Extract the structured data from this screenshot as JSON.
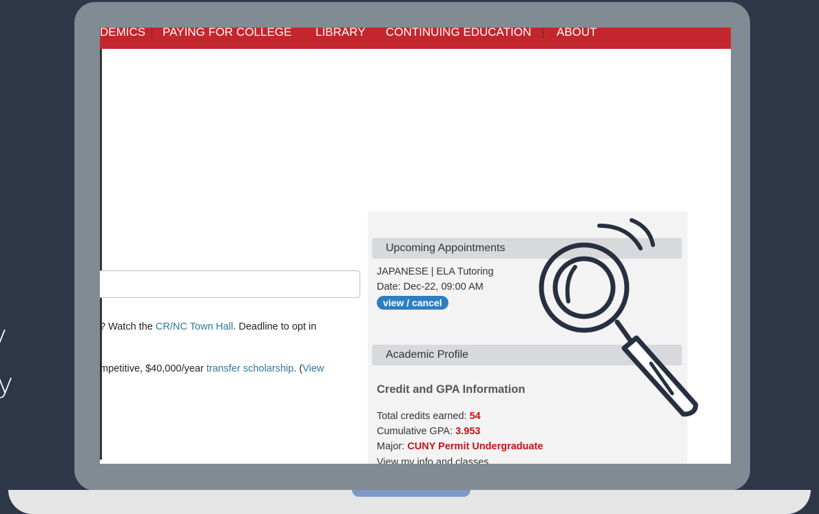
{
  "slide_text": {
    "line1": "ny",
    "line2": "My"
  },
  "nav": {
    "items": [
      "DEMICS",
      "PAYING FOR COLLEGE",
      "LIBRARY",
      "CONTINUING EDUCATION",
      "ABOUT"
    ]
  },
  "announcements": {
    "line1_pre": "? Watch the ",
    "line1_link": "CR/NC Town Hall",
    "line1_post": ". Deadline to opt in",
    "line2_pre": "mpetitive, $40,000/year ",
    "line2_link": "transfer scholarship",
    "line2_post": ". (",
    "line2_link2": "View"
  },
  "appointments": {
    "header": "Upcoming Appointments",
    "item": "JAPANESE | ELA Tutoring",
    "date": "Date: Dec-22, 09:00 AM",
    "action": "view / cancel"
  },
  "profile": {
    "header": "Academic Profile",
    "section_title": "Credit and GPA Information",
    "credits_label": "Total credits earned: ",
    "credits_value": "54",
    "gpa_label": "Cumulative GPA: ",
    "gpa_value": "3.953",
    "major_label": "Major: ",
    "major_value": "CUNY Permit Undergraduate",
    "view_link": "View my info and classes"
  },
  "colors": {
    "background": "#2d3748",
    "nav_red": "#c4262e",
    "link_blue": "#2a7a9a",
    "value_red": "#c8121a",
    "pill_blue": "#2f7ec1",
    "laptop_gray": "#818b94"
  },
  "icons": {
    "overlay": "magnifying-glass-icon"
  }
}
